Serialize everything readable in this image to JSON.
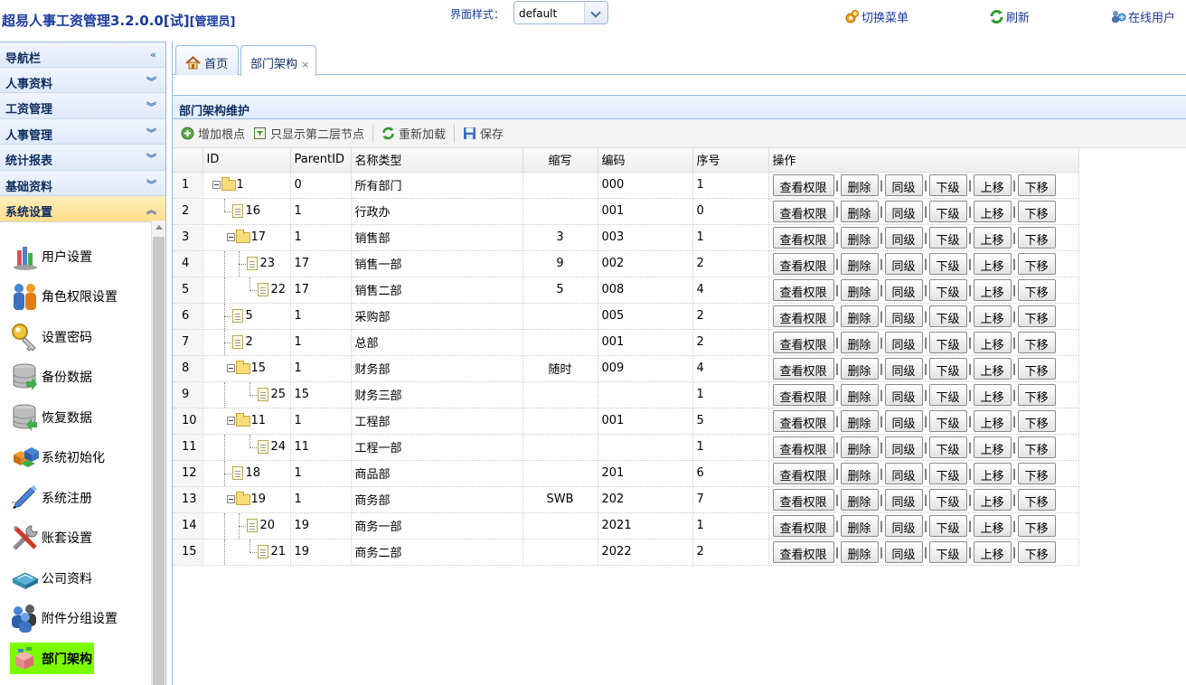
{
  "header": {
    "app_title": "超易人事工资管理3.2.0.0[试]",
    "role": "[管理员]",
    "theme_label": "界面样式：",
    "theme_value": "default",
    "links": {
      "switch_menu": "切换菜单",
      "refresh": "刷新",
      "online_users": "在线用户"
    }
  },
  "sidebar": {
    "title": "导航栏",
    "sections": [
      "人事资料",
      "工资管理",
      "人事管理",
      "统计报表",
      "基础资料",
      "系统设置"
    ],
    "active_section": "系统设置",
    "items": [
      {
        "label": "用户设置",
        "icon": "users-chart-icon"
      },
      {
        "label": "角色权限设置",
        "icon": "roles-icon"
      },
      {
        "label": "设置密码",
        "icon": "key-icon"
      },
      {
        "label": "备份数据",
        "icon": "backup-db-icon"
      },
      {
        "label": "恢复数据",
        "icon": "restore-db-icon"
      },
      {
        "label": "系统初始化",
        "icon": "init-blocks-icon"
      },
      {
        "label": "系统注册",
        "icon": "register-pen-icon"
      },
      {
        "label": "账套设置",
        "icon": "tools-icon"
      },
      {
        "label": "公司资料",
        "icon": "company-book-icon"
      },
      {
        "label": "附件分组设置",
        "icon": "group-users-icon"
      },
      {
        "label": "部门架构",
        "icon": "org-structure-icon"
      }
    ],
    "selected_item": "部门架构"
  },
  "tabs": [
    {
      "label": "首页",
      "icon": "home-icon"
    },
    {
      "label": "部门架构",
      "closable": true
    }
  ],
  "panel": {
    "title": "部门架构维护",
    "toolbar": {
      "add_root": "增加根点",
      "show_second_level": "只显示第二层节点",
      "reload": "重新加载",
      "save": "保存"
    }
  },
  "table": {
    "columns": [
      "ID",
      "ParentID",
      "名称类型",
      "缩写",
      "编码",
      "序号",
      "操作"
    ],
    "action_labels": [
      "查看权限",
      "删除",
      "同级",
      "下级",
      "上移",
      "下移"
    ],
    "rows": [
      {
        "rn": "1",
        "id": "1",
        "parent": "0",
        "name": "所有部门",
        "abbr": "",
        "code": "000",
        "seq": "1"
      },
      {
        "rn": "2",
        "id": "16",
        "parent": "1",
        "name": "行政办",
        "abbr": "",
        "code": "001",
        "seq": "0"
      },
      {
        "rn": "3",
        "id": "17",
        "parent": "1",
        "name": "销售部",
        "abbr": "3",
        "code": "003",
        "seq": "1"
      },
      {
        "rn": "4",
        "id": "23",
        "parent": "17",
        "name": "销售一部",
        "abbr": "9",
        "code": "002",
        "seq": "2"
      },
      {
        "rn": "5",
        "id": "22",
        "parent": "17",
        "name": "销售二部",
        "abbr": "5",
        "code": "008",
        "seq": "4"
      },
      {
        "rn": "6",
        "id": "5",
        "parent": "1",
        "name": "采购部",
        "abbr": "",
        "code": "005",
        "seq": "2"
      },
      {
        "rn": "7",
        "id": "2",
        "parent": "1",
        "name": "总部",
        "abbr": "",
        "code": "001",
        "seq": "2"
      },
      {
        "rn": "8",
        "id": "15",
        "parent": "1",
        "name": "财务部",
        "abbr": "随时",
        "code": "009",
        "seq": "4"
      },
      {
        "rn": "9",
        "id": "25",
        "parent": "15",
        "name": "财务三部",
        "abbr": "",
        "code": "",
        "seq": "1"
      },
      {
        "rn": "10",
        "id": "11",
        "parent": "1",
        "name": "工程部",
        "abbr": "",
        "code": "001",
        "seq": "5"
      },
      {
        "rn": "11",
        "id": "24",
        "parent": "11",
        "name": "工程一部",
        "abbr": "",
        "code": "",
        "seq": "1"
      },
      {
        "rn": "12",
        "id": "18",
        "parent": "1",
        "name": "商品部",
        "abbr": "",
        "code": "201",
        "seq": "6"
      },
      {
        "rn": "13",
        "id": "19",
        "parent": "1",
        "name": "商务部",
        "abbr": "SWB",
        "code": "202",
        "seq": "7"
      },
      {
        "rn": "14",
        "id": "20",
        "parent": "19",
        "name": "商务一部",
        "abbr": "",
        "code": "2021",
        "seq": "1"
      },
      {
        "rn": "15",
        "id": "21",
        "parent": "19",
        "name": "商务二部",
        "abbr": "",
        "code": "2022",
        "seq": "2"
      }
    ]
  }
}
